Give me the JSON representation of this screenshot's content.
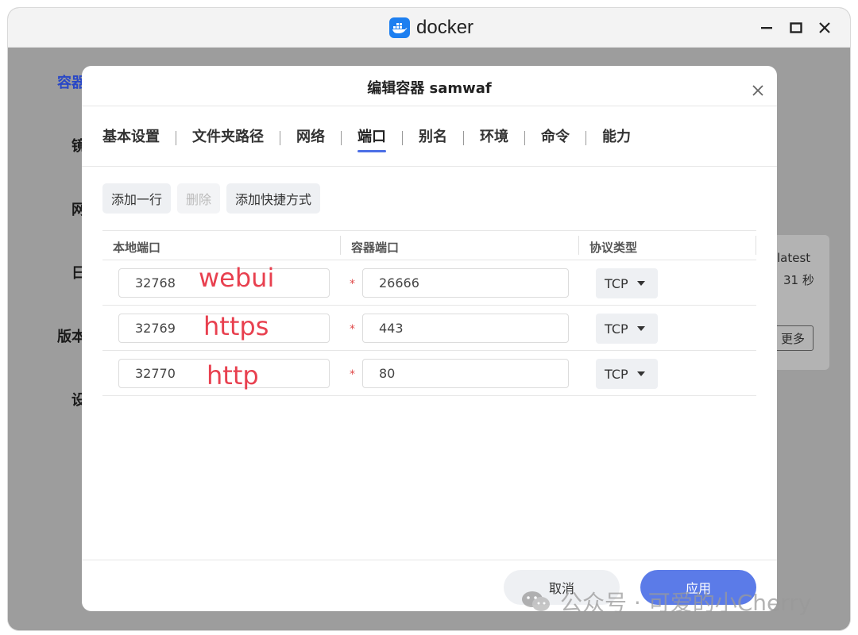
{
  "window": {
    "app_title": "docker"
  },
  "background": {
    "sidebar": [
      "容器",
      "镜",
      "网",
      "日",
      "版本",
      "设"
    ],
    "card": {
      "line1": "latest",
      "line2": "31 秒",
      "button": "更多"
    }
  },
  "dialog": {
    "title": "编辑容器 samwaf",
    "tabs": [
      {
        "label": "基本设置"
      },
      {
        "label": "文件夹路径"
      },
      {
        "label": "网络"
      },
      {
        "label": "端口"
      },
      {
        "label": "别名"
      },
      {
        "label": "环境"
      },
      {
        "label": "命令"
      },
      {
        "label": "能力"
      }
    ],
    "active_tab": "端口",
    "toolbar": {
      "add_row": "添加一行",
      "delete": "删除",
      "add_shortcut": "添加快捷方式"
    },
    "table": {
      "headers": [
        "本地端口",
        "容器端口",
        "协议类型"
      ],
      "rows": [
        {
          "local": "32768",
          "container": "26666",
          "protocol": "TCP",
          "annotation": "webui"
        },
        {
          "local": "32769",
          "container": "443",
          "protocol": "TCP",
          "annotation": "https"
        },
        {
          "local": "32770",
          "container": "80",
          "protocol": "TCP",
          "annotation": "http"
        }
      ],
      "required_mark": "*"
    },
    "footer": {
      "cancel": "取消",
      "apply": "应用"
    }
  },
  "watermark": {
    "text": "公众号 · 可爱的小Cherry"
  },
  "colors": {
    "accent": "#5b7be8",
    "tab_underline": "#4c6fe6",
    "annotation": "#e8404f",
    "required": "#e04a4a",
    "sidebar_active": "#2847c7"
  }
}
